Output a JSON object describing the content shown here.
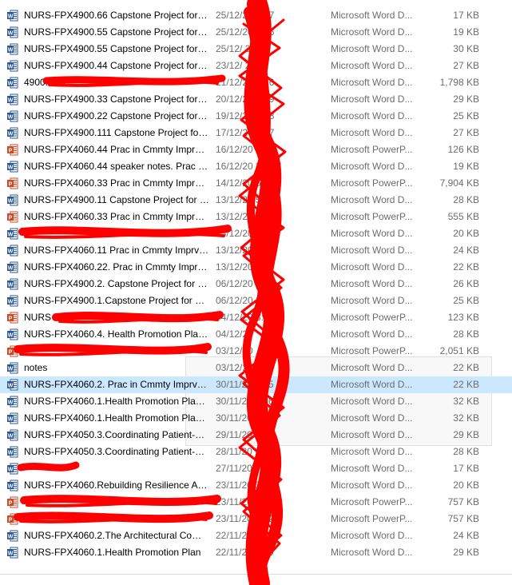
{
  "files": [
    {
      "icon": "word",
      "name": "NURS-FPX4900.66 Capstone Project for N...",
      "date": "25/12/20  3:27",
      "type": "Microsoft Word D...",
      "size": "17 KB"
    },
    {
      "icon": "word",
      "name": "NURS-FPX4900.55 Capstone Project for N...",
      "date": "25/12/20  3:26",
      "type": "Microsoft Word D...",
      "size": "19 KB"
    },
    {
      "icon": "word",
      "name": "NURS-FPX4900.55 Capstone Project for N...",
      "date": "25/12/  38",
      "type": "Microsoft Word D...",
      "size": "30 KB"
    },
    {
      "icon": "word",
      "name": "NURS-FPX4900.44 Capstone Project for N...",
      "date": "23/12/  24",
      "type": "Microsoft Word D...",
      "size": "27 KB"
    },
    {
      "icon": "word",
      "name": "4900.44.1",
      "date": "21/12/20  3:26",
      "type": "Microsoft Word D...",
      "size": "1,798 KB"
    },
    {
      "icon": "word",
      "name": "NURS-FPX4900.33 Capstone Project for N...",
      "date": "20/12/20  1:19",
      "type": "Microsoft Word D...",
      "size": "29 KB"
    },
    {
      "icon": "word",
      "name": "NURS-FPX4900.22 Capstone Project for N...",
      "date": "19/12/20  1:38",
      "type": "Microsoft Word D...",
      "size": "25 KB"
    },
    {
      "icon": "word",
      "name": "NURS-FPX4900.111 Capstone Project for ...",
      "date": "17/12/20  5:07",
      "type": "Microsoft Word D...",
      "size": "27 KB"
    },
    {
      "icon": "ppt",
      "name": "NURS-FPX4060.44 Prac in Cmmty Imprv ...",
      "date": "16/12/20  3:59",
      "type": "Microsoft PowerP...",
      "size": "126 KB"
    },
    {
      "icon": "word",
      "name": "NURS-FPX4060.44 speaker notes. Prac in ...",
      "date": "16/12/20  3:58",
      "type": "Microsoft Word D...",
      "size": "19 KB"
    },
    {
      "icon": "ppt",
      "name": "NURS-FPX4060.33 Prac in Cmmty Imprv ...",
      "date": "14/12/20  5:10",
      "type": "Microsoft PowerP...",
      "size": "7,904 KB"
    },
    {
      "icon": "word",
      "name": "NURS-FPX4900.11 Capstone Project for N...",
      "date": "13/12/20  5:31",
      "type": "Microsoft Word D...",
      "size": "28 KB"
    },
    {
      "icon": "ppt",
      "name": "NURS-FPX4060.33 Prac in Cmmty Imprv ...",
      "date": "13/12/20  3:31",
      "type": "Microsoft PowerP...",
      "size": "555 KB"
    },
    {
      "icon": "word",
      "name": "",
      "date": "13/12/20  3:31",
      "type": "Microsoft Word D...",
      "size": "20 KB"
    },
    {
      "icon": "word",
      "name": "NURS-FPX4060.11 Prac in Cmmty Imprv ...",
      "date": "13/12/20  4:23",
      "type": "Microsoft Word D...",
      "size": "24 KB"
    },
    {
      "icon": "word",
      "name": "NURS-FPX4060.22. Prac in Cmmty Imprv ...",
      "date": "13/12/20  3:07",
      "type": "Microsoft Word D...",
      "size": "22 KB"
    },
    {
      "icon": "word",
      "name": "NURS-FPX4900.2. Capstone Project for N...",
      "date": "06/12/20  4:36",
      "type": "Microsoft Word D...",
      "size": "26 KB"
    },
    {
      "icon": "word",
      "name": "NURS-FPX4900.1.Capstone Project for N...",
      "date": "06/12/20  2:55",
      "type": "Microsoft Word D...",
      "size": "25 KB"
    },
    {
      "icon": "ppt",
      "name": "NURS 4060",
      "date": "04/12/20  3:31",
      "type": "Microsoft PowerP...",
      "size": "123 KB"
    },
    {
      "icon": "word",
      "name": "NURS-FPX4060.4. Health Promotion Plan...",
      "date": "04/12/20",
      "type": "Microsoft Word D...",
      "size": "28 KB"
    },
    {
      "icon": "ppt",
      "name": "",
      "date": "03/12/20",
      "type": "Microsoft PowerP...",
      "size": "2,051 KB"
    },
    {
      "icon": "word",
      "name": "notes",
      "date": "03/12/20",
      "type": "Microsoft Word D...",
      "size": "22 KB"
    },
    {
      "icon": "word",
      "name": "NURS-FPX4060.2. Prac in Cmmty Imprv P...",
      "date": "30/11/20  4:05",
      "type": "Microsoft Word D...",
      "size": "22 KB",
      "selected": true
    },
    {
      "icon": "word",
      "name": "NURS-FPX4060.1.Health Promotion Plan....",
      "date": "30/11/20  5:56",
      "type": "Microsoft Word D...",
      "size": "32 KB"
    },
    {
      "icon": "word",
      "name": "NURS-FPX4060.1.Health Promotion Plan....",
      "date": "30/11/20  5:56",
      "type": "Microsoft Word D...",
      "size": "32 KB"
    },
    {
      "icon": "word",
      "name": "NURS-FPX4050.3.Coordinating Patient-C...",
      "date": "29/11/20  1:32",
      "type": "Microsoft Word D...",
      "size": "29 KB"
    },
    {
      "icon": "word",
      "name": "NURS-FPX4050.3.Coordinating Patient-C...",
      "date": "28/11/20  1:32",
      "type": "Microsoft Word D...",
      "size": "28 KB"
    },
    {
      "icon": "word",
      "name": "",
      "date": "27/11/20",
      "type": "Microsoft Word D...",
      "size": "17 KB"
    },
    {
      "icon": "word",
      "name": "NURS-FPX4060.Rebuilding Resilience Aft...",
      "date": "23/11/20  3:55",
      "type": "Microsoft Word D...",
      "size": "20 KB"
    },
    {
      "icon": "ppt",
      "name": "",
      "date": "23/11/20  4:53",
      "type": "Microsoft PowerP...",
      "size": "757 KB"
    },
    {
      "icon": "ppt",
      "name": "",
      "date": "23/11/20  4:52",
      "type": "Microsoft PowerP...",
      "size": "757 KB"
    },
    {
      "icon": "word",
      "name": "NURS-FPX4060.2.The Architectural Comp...",
      "date": "22/11/20  5:11",
      "type": "Microsoft Word D...",
      "size": "24 KB"
    },
    {
      "icon": "word",
      "name": "NURS-FPX4060.1.Health Promotion Plan",
      "date": "22/11/20  4:26",
      "type": "Microsoft Word D...",
      "size": "29 KB"
    }
  ],
  "colors": {
    "word": "#2b579a",
    "ppt": "#d24726",
    "scribble": "#ff0000",
    "selected_bg": "#cce8ff"
  }
}
